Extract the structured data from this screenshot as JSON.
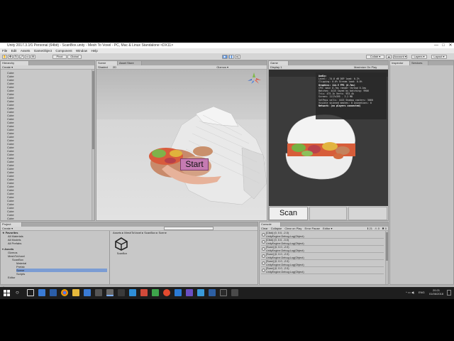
{
  "window": {
    "title": "Unity 2017.3.1f1 Personal (64bit) - ScanBox.unity - Mesh To Voxel - PC, Mac & Linux Standalone <DX11>",
    "minimize": "—",
    "maximize": "□",
    "close": "✕"
  },
  "menu": [
    "File",
    "Edit",
    "Assets",
    "GameObject",
    "Component",
    "Window",
    "Help"
  ],
  "toolbar": {
    "pivot": "Pivot",
    "global": "Global",
    "collab": "Collab ▾",
    "account": "Account ▾",
    "layers": "Layers ▾",
    "layout": "Layout ▾"
  },
  "hierarchy": {
    "tab": "Hierarchy",
    "create": "Create ▾",
    "items": [
      "Cube",
      "Cube",
      "Cube",
      "Cube",
      "Cube",
      "Cube",
      "Cube",
      "Cube",
      "Cube",
      "Cube",
      "Cube",
      "Cube",
      "Cube",
      "Cube",
      "Cube",
      "Cube",
      "Cube",
      "Cube",
      "Cube",
      "Cube",
      "Cube",
      "Cube",
      "Cube",
      "Cube",
      "Cube",
      "Cube",
      "Cube",
      "Cube",
      "Cube",
      "Cube",
      "Cube",
      "Cube",
      "Cube",
      "Cube",
      "Cube",
      "Cube",
      "Cube",
      "Cube",
      "Cube",
      "Cube",
      "Cube",
      "Cube",
      "Cube"
    ]
  },
  "scene": {
    "tab": "Scene",
    "tab2": "Asset Store",
    "shading": "Shaded",
    "mode2d": "2D",
    "gizmos": "Gizmos ▾",
    "start_label": "Start"
  },
  "game": {
    "tab": "Game",
    "display": "Display 1",
    "maximize": "Maximize On Play",
    "mute": "Mute Audio",
    "stats_btn": "Stats",
    "gizmos": "Gizmos",
    "scan_label": "Scan",
    "stats": {
      "audio_h": "Audio:",
      "audio1": "Level: -74.8 dB     DSP load: 0.2%",
      "audio2": "Clipping: 0.0%      Stream load: 0.0%",
      "graphics_h": "Graphics:           114.5 FPS (8.7ms)",
      "g1": "CPU: main 8.7ms   render thread 0.1ms",
      "g2": "Batches: 4415     Saved by batching: 9906",
      "g3": "Tris: 475.1k      Verts: 953.4k",
      "g4": "Screen: 1117x395 - 3.2 MB",
      "g5": "SetPass calls: 4415   Shadow casters: 5060",
      "g6": "Visible skinned meshes: 0   Animations: 0",
      "net_h": "Network: (no players connected)"
    }
  },
  "inspector": {
    "tab": "Inspector",
    "tab2": "Services"
  },
  "project": {
    "tab": "Project",
    "create": "Create ▾",
    "favorites": "Favorites",
    "fav_items": [
      "All Materials",
      "All Models",
      "All Prefabs"
    ],
    "assets": "Assets",
    "tree": [
      "Gizmos",
      "MeshToVoxel",
      "ScanBox",
      "Material",
      "Prefab",
      "Scene",
      "Scripts",
      "Editor"
    ],
    "breadcrumb": "Assets ▸ MeshToVoxel ▸ ScanBox ▸ Scene",
    "file_name": "ScanBox"
  },
  "console": {
    "tab": "Console",
    "buttons": [
      "Clear",
      "Collapse",
      "Clear on Play",
      "Error Pause",
      "Editor ▾"
    ],
    "counts": [
      "ℹ 21",
      "⚠ 0",
      "✖ 0"
    ],
    "rows": [
      {
        "line1": "[Click] (0, 0.0, -2.0)",
        "line2": "UnityEngine.Debug:Log(Object)"
      },
      {
        "line1": "[Click] (0, 0.0, -3.0)",
        "line2": "UnityEngine.Debug:Log(Object)"
      },
      {
        "line1": "[Scan] (0, 0.0, -2.0)",
        "line2": "UnityEngine.Debug:Log(Object)"
      },
      {
        "line1": "[Scan] (0, 0.0, -2.0)",
        "line2": "UnityEngine.Debug:Log(Object)"
      },
      {
        "line1": "[Scan] (0, 0.0, -2.0)",
        "line2": "UnityEngine.Debug:Log(Object)"
      },
      {
        "line1": "[Scan] (0, 0.0, -2.0)",
        "line2": "UnityEngine.Debug:Log(Object)"
      }
    ]
  },
  "status": "[Scan] (0, 0.0, -2.0)",
  "taskbar": {
    "time": "20:21",
    "date": "01/06/2018",
    "lang": "ENG"
  }
}
